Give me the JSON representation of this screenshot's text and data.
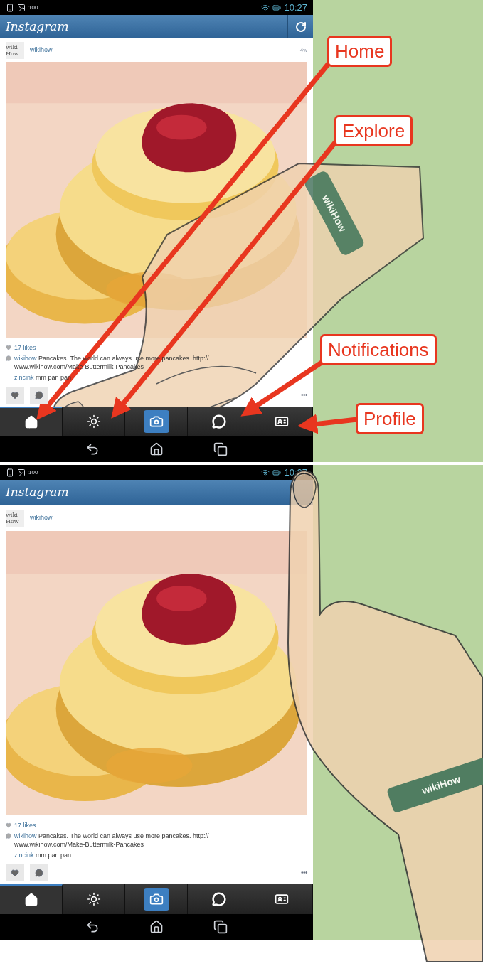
{
  "panels": [
    {
      "status_bar": {
        "battery": "100",
        "time": "10:27"
      },
      "app_bar": {
        "title": "Instagram",
        "refresh_button": true
      },
      "post": {
        "avatar": "wiki How",
        "user": "wikihow",
        "age": "4w",
        "likes": "17 likes",
        "caption_user": "wikihow",
        "caption": "Pancakes. The world can always use more pancakes. http:// www.wikihow.com/Make-Buttermilk-Pancakes",
        "comment_user": "zincink",
        "comment": "mm pan pan",
        "more": "•••"
      },
      "tabs": [
        {
          "kind": "home",
          "selected": true
        },
        {
          "kind": "explore",
          "selected": false
        },
        {
          "kind": "camera",
          "selected": false
        },
        {
          "kind": "notifications",
          "selected": false
        },
        {
          "kind": "profile",
          "selected": false
        }
      ],
      "hand": {
        "kind": "tap-bottom",
        "band_text": "wikiHow"
      },
      "callouts": [
        {
          "label": "Home"
        },
        {
          "label": "Explore"
        },
        {
          "label": "Notifications"
        },
        {
          "label": "Profile"
        }
      ]
    },
    {
      "status_bar": {
        "battery": "100",
        "time": "10:27"
      },
      "app_bar": {
        "title": "Instagram"
      },
      "post": {
        "avatar": "wiki How",
        "user": "wikihow",
        "likes": "17 likes",
        "caption_user": "wikihow",
        "caption": "Pancakes. The world can always use more pancakes. http:// www.wikihow.com/Make-Buttermilk-Pancakes",
        "comment_user": "zincink",
        "comment": "mm pan pan",
        "more": "•••"
      },
      "tabs": [
        {
          "kind": "home",
          "selected": true
        },
        {
          "kind": "explore",
          "selected": false
        },
        {
          "kind": "camera",
          "selected": false
        },
        {
          "kind": "notifications",
          "selected": false
        },
        {
          "kind": "profile",
          "selected": false
        }
      ],
      "hand": {
        "kind": "tap-top",
        "band_text": "wikiHow"
      }
    }
  ]
}
